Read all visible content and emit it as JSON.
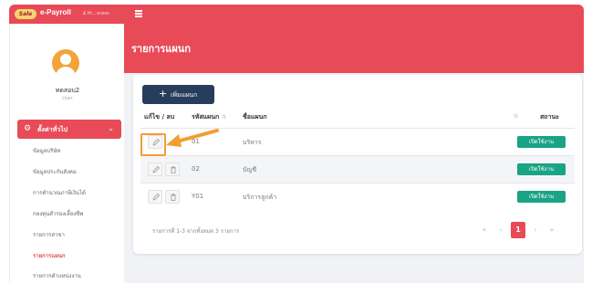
{
  "header": {
    "logo_text": "Sale",
    "app_name": "e-Payroll",
    "app_subtitle": "& Hr... ersion",
    "page_title": "รายการแผนก"
  },
  "user": {
    "name": "ทดสอบ2",
    "role": "User"
  },
  "sidebar": {
    "main_menu_label": "ตั้งค่าทั่วไป",
    "items": [
      {
        "label": "ข้อมูลบริษัท"
      },
      {
        "label": "ข้อมูลประกันสังคม"
      },
      {
        "label": "การคำนวณภาษีเงินได้"
      },
      {
        "label": "กองทุนสำรองเลี้ยงชีพ"
      },
      {
        "label": "รายการสาขา"
      },
      {
        "label": "รายการแผนก"
      },
      {
        "label": "รายการตำแหน่งงาน"
      }
    ]
  },
  "toolbar": {
    "add_label": "เพิ่มแผนก"
  },
  "table": {
    "headers": {
      "edit_delete": "แก้ไข / ลบ",
      "code": "รหัสแผนก",
      "name": "ชื่อแผนก",
      "status": "สถานะ"
    },
    "rows": [
      {
        "code": "01",
        "name": "บริหาร",
        "status": "เปิดใช้งาน"
      },
      {
        "code": "02",
        "name": "บัญชี",
        "status": "เปิดใช้งาน"
      },
      {
        "code": "Y01",
        "name": "บริการลูกค้า",
        "status": "เปิดใช้งาน"
      }
    ]
  },
  "footer": {
    "summary": "รายการที่ 1-3 จากทั้งหมด 3 รายการ"
  },
  "pagination": {
    "first": "«",
    "prev": "‹",
    "current": "1",
    "next": "›",
    "last": "»"
  },
  "colors": {
    "brand": "#e84a57",
    "primary_button": "#263d5c",
    "status_active": "#1aa384",
    "callout": "#f39c33"
  }
}
